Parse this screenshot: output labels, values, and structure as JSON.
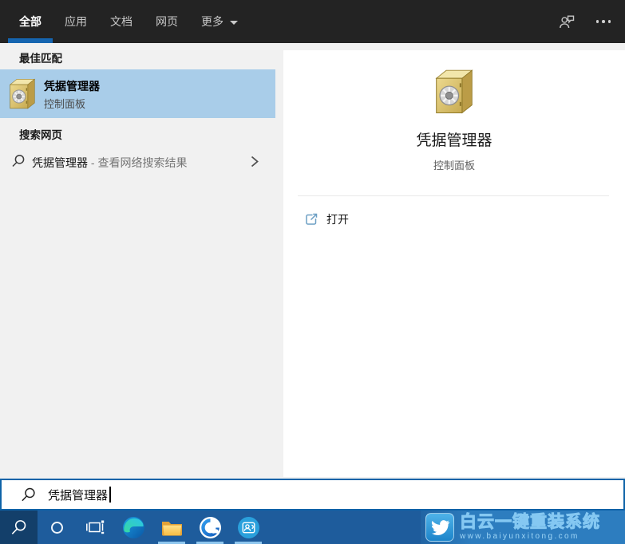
{
  "header": {
    "tabs": [
      {
        "label": "全部",
        "active": true
      },
      {
        "label": "应用",
        "active": false
      },
      {
        "label": "文档",
        "active": false
      },
      {
        "label": "网页",
        "active": false
      },
      {
        "label": "更多",
        "active": false,
        "has_dropdown": true
      }
    ],
    "icons": [
      "feedback-icon",
      "more-options-icon"
    ]
  },
  "left_panel": {
    "best_match_header": "最佳匹配",
    "best_match_item": {
      "title": "凭据管理器",
      "subtitle": "控制面板",
      "icon": "safe-icon"
    },
    "web_search_header": "搜索网页",
    "web_search_item": {
      "query": "凭据管理器",
      "suffix": " - 查看网络搜索结果",
      "icon": "search-icon"
    }
  },
  "right_panel": {
    "title": "凭据管理器",
    "subtitle": "控制面板",
    "icon": "safe-icon",
    "open_action": "打开"
  },
  "search_bar": {
    "value": "凭据管理器",
    "icon": "search-icon"
  },
  "taskbar": {
    "apps": [
      "search",
      "cortana",
      "task-view",
      "edge",
      "file-explorer",
      "qq-browser",
      "contacts"
    ],
    "active_app": "search",
    "running_indicators": [
      "file-explorer",
      "qq-browser",
      "contacts"
    ],
    "watermark": {
      "title": "白云一键重装系统",
      "url": "www.baiyunxitong.com",
      "icon": "bird-icon"
    }
  },
  "colors": {
    "accent_blue": "#1565b0",
    "selection_blue": "#a9cde9",
    "taskbar_blue": "#1e5c9c",
    "taskbar_active_tile": "#133f6a",
    "searchbox_border": "#0e63a8",
    "watermark_text_blue": "#85c8f2",
    "topbar_dark": "#232323"
  }
}
